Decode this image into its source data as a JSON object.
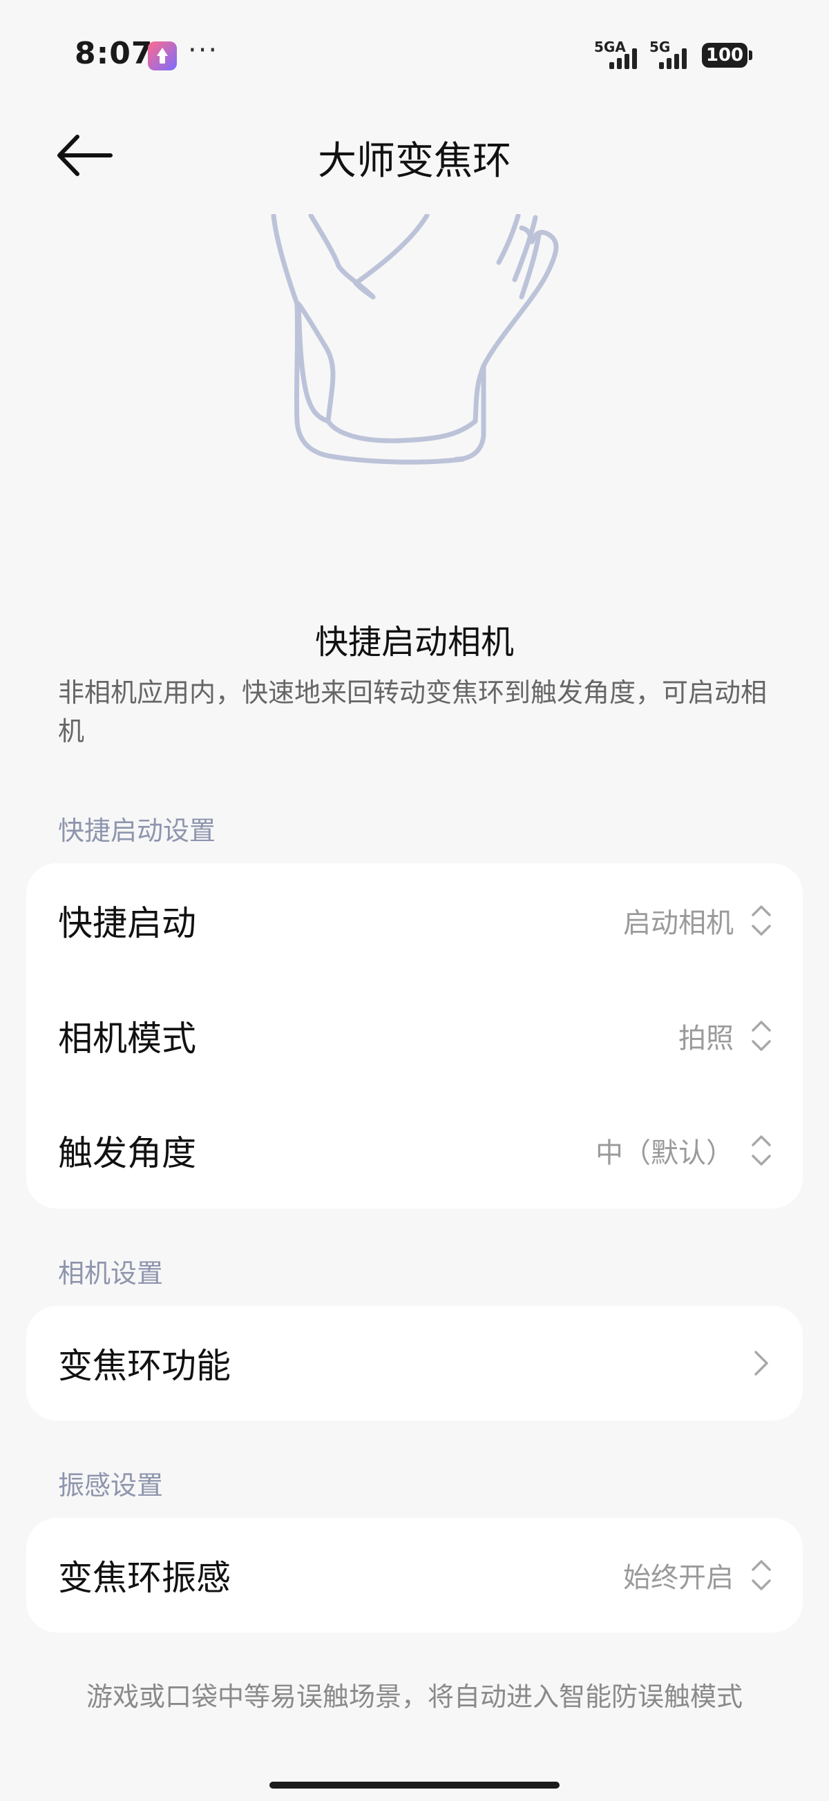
{
  "status_bar": {
    "time": "8:07",
    "more": "···",
    "sim1_label": "5GA",
    "sim2_label": "5G",
    "battery": "100",
    "app_notification_icon": "upload-arrow-icon"
  },
  "header": {
    "title": "大师变焦环",
    "back_icon": "arrow-left-icon"
  },
  "illustration": {
    "icon": "hand-holding-ring-icon",
    "stroke_color": "#bcc3d9"
  },
  "feature": {
    "title": "快捷启动相机",
    "description": "非相机应用内，快速地来回转动变焦环到触发角度，可启动相机"
  },
  "sections": [
    {
      "header": "快捷启动设置",
      "rows": [
        {
          "label": "快捷启动",
          "value": "启动相机",
          "icon": "chevron-up-down-icon"
        },
        {
          "label": "相机模式",
          "value": "拍照",
          "icon": "chevron-up-down-icon"
        },
        {
          "label": "触发角度",
          "value": "中（默认）",
          "icon": "chevron-up-down-icon"
        }
      ]
    },
    {
      "header": "相机设置",
      "rows": [
        {
          "label": "变焦环功能",
          "value": "",
          "icon": "chevron-right-icon"
        }
      ]
    },
    {
      "header": "振感设置",
      "rows": [
        {
          "label": "变焦环振感",
          "value": "始终开启",
          "icon": "chevron-up-down-icon"
        }
      ]
    }
  ],
  "footnote": "游戏或口袋中等易误触场景，将自动进入智能防误触模式",
  "colors": {
    "background": "#f7f7f7",
    "card": "#ffffff",
    "section_header": "#8e95ad",
    "secondary_text": "#9a9a9a"
  }
}
